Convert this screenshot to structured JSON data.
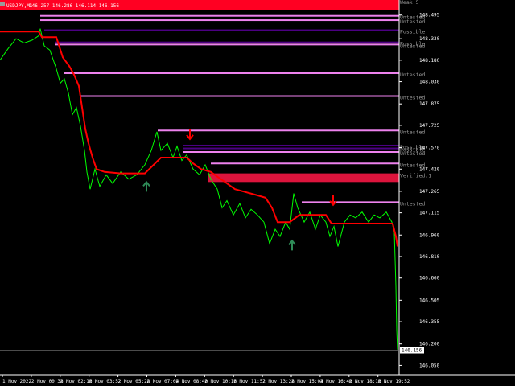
{
  "header": {
    "symbol": "USDJPY,M1",
    "ohlc": "146.257 146.286 146.114 146.156"
  },
  "colors": {
    "background": "#000000",
    "price_line": "#00ff00",
    "trend_line": "#ff0000",
    "trend_line_up": "#1f6e1f",
    "axis": "#ffffff",
    "zone_weak": "#ff0022",
    "zone_untested": "#ee82ee",
    "zone_possible": "#4b0082",
    "zone_verified": "#dc143c"
  },
  "chart_data": {
    "type": "line",
    "title": "",
    "xlabel": "",
    "ylabel": "",
    "ylim": [
      145.985,
      148.6
    ],
    "y_ticks": [
      "148.495",
      "148.330",
      "148.180",
      "148.030",
      "147.875",
      "147.725",
      "147.570",
      "147.420",
      "147.265",
      "147.115",
      "146.960",
      "146.810",
      "146.660",
      "146.505",
      "146.355",
      "146.200",
      "146.050"
    ],
    "current_price_label": "146.156",
    "current_price": 146.156,
    "x_ticks": [
      "1 Nov 2022",
      "2 Nov 00:38",
      "2 Nov 02:16",
      "2 Nov 03:52",
      "2 Nov 05:28",
      "2 Nov 07:04",
      "2 Nov 08:40",
      "2 Nov 10:16",
      "2 Nov 11:52",
      "2 Nov 13:28",
      "2 Nov 15:04",
      "2 Nov 16:40",
      "2 Nov 18:16",
      "2 Nov 19:52"
    ],
    "series": [
      {
        "values": [
          [
            0,
            148.18
          ],
          [
            10,
            148.26
          ],
          [
            20,
            148.33
          ],
          [
            30,
            148.3
          ],
          [
            40,
            148.32
          ],
          [
            48,
            148.35
          ],
          [
            50,
            148.4
          ],
          [
            55,
            148.28
          ],
          [
            62,
            148.25
          ],
          [
            70,
            148.12
          ],
          [
            75,
            148.02
          ],
          [
            80,
            148.05
          ],
          [
            85,
            147.95
          ],
          [
            90,
            147.8
          ],
          [
            95,
            147.85
          ],
          [
            100,
            147.72
          ],
          [
            105,
            147.55
          ],
          [
            108,
            147.4
          ],
          [
            112,
            147.28
          ],
          [
            118,
            147.42
          ],
          [
            124,
            147.3
          ],
          [
            132,
            147.38
          ],
          [
            140,
            147.32
          ],
          [
            150,
            147.4
          ],
          [
            160,
            147.35
          ],
          [
            170,
            147.38
          ],
          [
            180,
            147.45
          ],
          [
            188,
            147.55
          ],
          [
            195,
            147.68
          ],
          [
            200,
            147.55
          ],
          [
            208,
            147.6
          ],
          [
            215,
            147.5
          ],
          [
            220,
            147.58
          ],
          [
            226,
            147.48
          ],
          [
            232,
            147.52
          ],
          [
            240,
            147.42
          ],
          [
            248,
            147.38
          ],
          [
            255,
            147.45
          ],
          [
            262,
            147.35
          ],
          [
            270,
            147.28
          ],
          [
            276,
            147.15
          ],
          [
            282,
            147.2
          ],
          [
            290,
            147.1
          ],
          [
            298,
            147.18
          ],
          [
            305,
            147.08
          ],
          [
            312,
            147.14
          ],
          [
            320,
            147.1
          ],
          [
            328,
            147.05
          ],
          [
            335,
            146.9
          ],
          [
            342,
            147.0
          ],
          [
            348,
            146.95
          ],
          [
            355,
            147.05
          ],
          [
            360,
            147.0
          ],
          [
            365,
            147.25
          ],
          [
            370,
            147.15
          ],
          [
            378,
            147.05
          ],
          [
            385,
            147.12
          ],
          [
            392,
            147.0
          ],
          [
            398,
            147.1
          ],
          [
            405,
            147.05
          ],
          [
            410,
            146.95
          ],
          [
            415,
            147.02
          ],
          [
            420,
            146.88
          ],
          [
            428,
            147.05
          ],
          [
            435,
            147.1
          ],
          [
            442,
            147.08
          ],
          [
            450,
            147.12
          ],
          [
            458,
            147.05
          ],
          [
            465,
            147.1
          ],
          [
            472,
            147.08
          ],
          [
            480,
            147.12
          ],
          [
            487,
            147.05
          ],
          [
            490,
            146.98
          ],
          [
            492,
            146.6
          ],
          [
            493,
            146.3
          ],
          [
            494,
            146.16
          ]
        ]
      },
      {
        "values": [
          [
            0,
            148.38
          ],
          [
            48,
            148.38
          ],
          [
            52,
            148.34
          ],
          [
            70,
            148.34
          ],
          [
            78,
            148.2
          ],
          [
            86,
            148.14
          ],
          [
            92,
            148.08
          ],
          [
            98,
            148.0
          ],
          [
            102,
            147.85
          ],
          [
            106,
            147.7
          ],
          [
            110,
            147.6
          ],
          [
            115,
            147.5
          ],
          [
            120,
            147.42
          ],
          [
            130,
            147.4
          ],
          [
            150,
            147.39
          ],
          [
            180,
            147.39
          ],
          [
            200,
            147.5
          ],
          [
            232,
            147.5
          ],
          [
            240,
            147.46
          ],
          [
            250,
            147.42
          ],
          [
            262,
            147.4
          ],
          [
            272,
            147.36
          ],
          [
            282,
            147.32
          ],
          [
            292,
            147.28
          ],
          [
            305,
            147.26
          ],
          [
            318,
            147.24
          ],
          [
            330,
            147.22
          ],
          [
            338,
            147.15
          ],
          [
            345,
            147.05
          ],
          [
            360,
            147.05
          ],
          [
            372,
            147.1
          ],
          [
            405,
            147.1
          ],
          [
            412,
            147.04
          ],
          [
            420,
            147.04
          ],
          [
            450,
            147.04
          ],
          [
            470,
            147.04
          ],
          [
            488,
            147.04
          ],
          [
            492,
            146.95
          ],
          [
            494,
            146.88
          ]
        ]
      }
    ],
    "zones": [
      {
        "label": "Weak:5",
        "type": "weak",
        "y1": 148.53,
        "y2": 148.6,
        "x_start": 0
      },
      {
        "label": "Untested",
        "type": "untested",
        "y1": 148.485,
        "y2": 148.495,
        "x_start": 50
      },
      {
        "label": "Untested",
        "type": "untested",
        "y1": 148.455,
        "y2": 148.465,
        "x_start": 50
      },
      {
        "label": "Possible",
        "type": "possible",
        "y1": 148.385,
        "y2": 148.395,
        "x_start": 55
      },
      {
        "label": "Possible",
        "type": "possible",
        "y1": 148.3,
        "y2": 148.31,
        "x_start": 68
      },
      {
        "label": "Untested",
        "type": "untested",
        "y1": 148.285,
        "y2": 148.295,
        "x_start": 68
      },
      {
        "label": "Untested",
        "type": "untested",
        "y1": 148.085,
        "y2": 148.095,
        "x_start": 80
      },
      {
        "label": "Untested",
        "type": "untested",
        "y1": 147.925,
        "y2": 147.935,
        "x_start": 100
      },
      {
        "label": "Untested",
        "type": "untested",
        "y1": 147.685,
        "y2": 147.695,
        "x_start": 196
      },
      {
        "label": "Possible",
        "type": "possible",
        "y1": 147.58,
        "y2": 147.59,
        "x_start": 228
      },
      {
        "label": "Possible",
        "type": "possible",
        "y1": 147.56,
        "y2": 147.57,
        "x_start": 228
      },
      {
        "label": "Untested",
        "type": "untested",
        "y1": 147.535,
        "y2": 147.545,
        "x_start": 228
      },
      {
        "label": "Untested",
        "type": "untested",
        "y1": 147.455,
        "y2": 147.465,
        "x_start": 262
      },
      {
        "label": "Verified:1",
        "type": "verified",
        "y1": 147.33,
        "y2": 147.39,
        "x_start": 258
      },
      {
        "label": "Untested",
        "type": "untested",
        "y1": 147.185,
        "y2": 147.195,
        "x_start": 375
      }
    ],
    "arrows": [
      {
        "dir": "down",
        "x": 236,
        "y": 147.63
      },
      {
        "dir": "down",
        "x": 414,
        "y": 147.17
      },
      {
        "dir": "up",
        "x": 182,
        "y": 147.33
      },
      {
        "dir": "up",
        "x": 363,
        "y": 146.92
      }
    ]
  }
}
